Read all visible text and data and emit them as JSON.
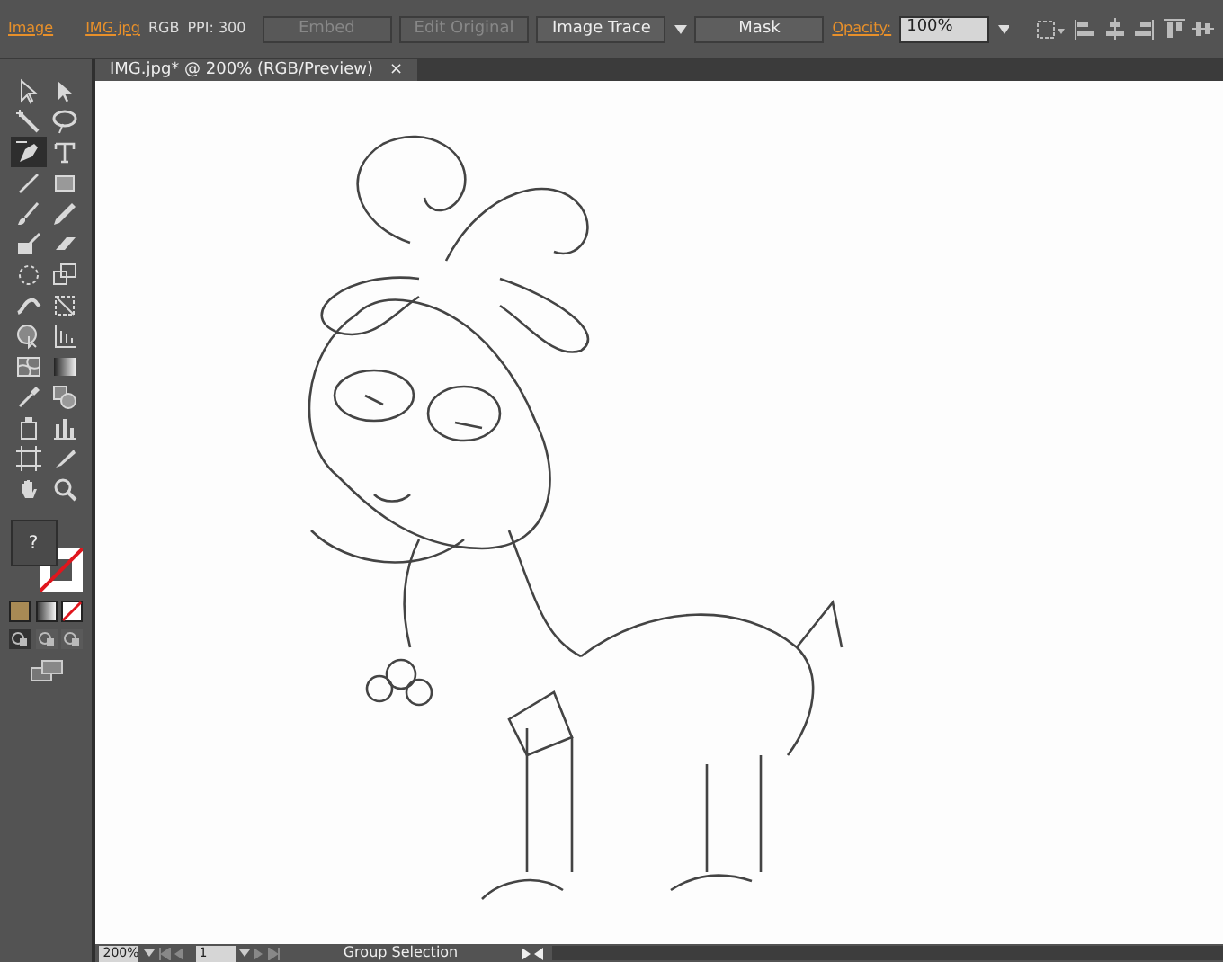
{
  "control_bar": {
    "object_type": "Image",
    "file_link": "IMG.jpg",
    "color_mode": "RGB",
    "ppi": "PPI: 300",
    "buttons": [
      {
        "label": "Embed",
        "disabled": true
      },
      {
        "label": "Edit Original",
        "disabled": true
      },
      {
        "label": "Image Trace",
        "disabled": false,
        "dropdown": true
      },
      {
        "label": "Mask",
        "disabled": false
      }
    ],
    "opacity_label": "Opacity:",
    "opacity_value": "100%"
  },
  "document_tab": {
    "title": "IMG.jpg* @ 200% (RGB/Preview)",
    "close": "×"
  },
  "tools": [
    {
      "kind": "select",
      "selected": false
    },
    {
      "kind": "direct",
      "selected": false
    },
    {
      "kind": "wand",
      "selected": false
    },
    {
      "kind": "lasso",
      "selected": false
    },
    {
      "kind": "pen",
      "selected": true
    },
    {
      "kind": "type",
      "selected": false
    },
    {
      "kind": "line",
      "selected": false
    },
    {
      "kind": "rect",
      "selected": false
    },
    {
      "kind": "brush",
      "selected": false
    },
    {
      "kind": "pencil",
      "selected": false
    },
    {
      "kind": "blob",
      "selected": false
    },
    {
      "kind": "eraser",
      "selected": false
    },
    {
      "kind": "rotate",
      "selected": false
    },
    {
      "kind": "scale",
      "selected": false
    },
    {
      "kind": "warp",
      "selected": false
    },
    {
      "kind": "transform",
      "selected": false
    },
    {
      "kind": "shapebuilder",
      "selected": false
    },
    {
      "kind": "perspective",
      "selected": false
    },
    {
      "kind": "mesh",
      "selected": false
    },
    {
      "kind": "gradient",
      "selected": false
    },
    {
      "kind": "eyedropper",
      "selected": false
    },
    {
      "kind": "blend",
      "selected": false
    },
    {
      "kind": "symbol",
      "selected": false
    },
    {
      "kind": "graph",
      "selected": false
    },
    {
      "kind": "artboard",
      "selected": false
    },
    {
      "kind": "slice",
      "selected": false
    },
    {
      "kind": "hand",
      "selected": false
    },
    {
      "kind": "zoom",
      "selected": false
    }
  ],
  "fill_stroke": {
    "fill_label": "?"
  },
  "status_bar": {
    "zoom": "200%",
    "page": "1",
    "current_tool": "Group Selection"
  }
}
